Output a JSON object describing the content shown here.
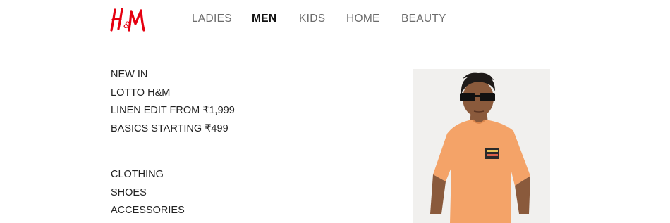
{
  "brand": {
    "logo_text": "H&M",
    "color": "#e50010"
  },
  "top_nav": {
    "items": [
      {
        "label": "LADIES",
        "active": false
      },
      {
        "label": "MEN",
        "active": true
      },
      {
        "label": "KIDS",
        "active": false
      },
      {
        "label": "HOME",
        "active": false
      },
      {
        "label": "BEAUTY",
        "active": false
      }
    ]
  },
  "menu": {
    "featured": [
      {
        "label": "NEW IN"
      },
      {
        "label": "LOTTO H&M"
      },
      {
        "label": "LINEN EDIT FROM ₹1,999"
      },
      {
        "label": "BASICS STARTING ₹499"
      }
    ],
    "categories": [
      {
        "label": "CLOTHING"
      },
      {
        "label": "SHOES"
      },
      {
        "label": "ACCESSORIES"
      }
    ]
  },
  "promo": {
    "image": "man-in-orange-t-shirt-and-sunglasses",
    "shirt_color": "#f4a368",
    "background_color": "#f1f0ee"
  },
  "colors": {
    "text_primary": "#111111",
    "text_muted": "#6b6b6b"
  }
}
